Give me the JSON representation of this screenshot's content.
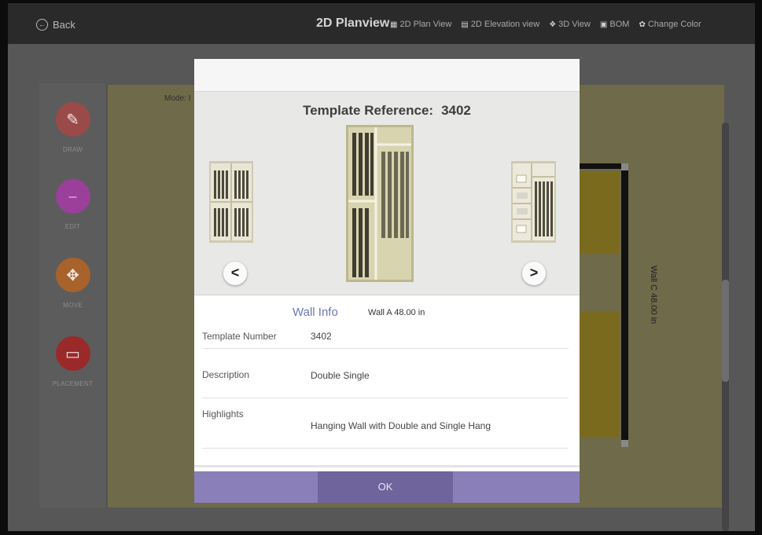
{
  "topbar": {
    "back_label": "Back",
    "title": "2D Planview",
    "nav": [
      {
        "icon": "plan-icon",
        "label": "2D Plan View"
      },
      {
        "icon": "elevation-icon",
        "label": "2D Elevation view"
      },
      {
        "icon": "cube-icon",
        "label": "3D View"
      },
      {
        "icon": "document-icon",
        "label": "BOM"
      },
      {
        "icon": "palette-icon",
        "label": "Change Color"
      }
    ]
  },
  "tools": [
    {
      "label": "DRAW",
      "color": "#9b4a4a",
      "icon": "pencil-icon"
    },
    {
      "label": "EDIT",
      "color": "#9a3f9a",
      "icon": "ruler-icon"
    },
    {
      "label": "MOVE",
      "color": "#a8622c",
      "icon": "move-icon"
    },
    {
      "label": "PLACEMENT",
      "color": "#9a2a2a",
      "icon": "placement-icon"
    }
  ],
  "canvas": {
    "mode_label": "Mode: I",
    "wall_label": "Wall C 48.00 in"
  },
  "modal": {
    "template_reference_label": "Template Reference:",
    "template_reference_value": "3402",
    "prev_label": "<",
    "next_label": ">",
    "wall_info_title": "Wall Info",
    "wall_info_value": "Wall A 48.00 in",
    "rows": [
      {
        "key": "Template Number",
        "value": "3402"
      },
      {
        "key": "Description",
        "value": "Double Single"
      },
      {
        "key": "Highlights",
        "value": "Hanging Wall with Double and Single Hang"
      }
    ],
    "ok_label": "OK"
  },
  "colors": {
    "accent_purple": "#8a7fb8",
    "wall_info_blue": "#6a78b8",
    "cabinet_olive": "#7a6a1e"
  }
}
